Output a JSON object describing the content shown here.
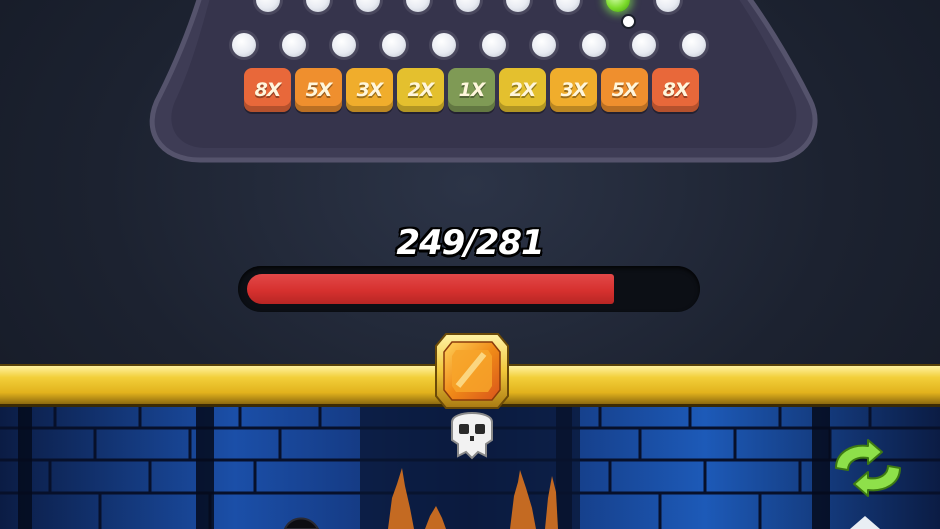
{
  "board": {
    "slots": [
      {
        "label": "8X",
        "color": "#e8683a"
      },
      {
        "label": "5X",
        "color": "#ef8f2e"
      },
      {
        "label": "3X",
        "color": "#f0ad2c"
      },
      {
        "label": "2X",
        "color": "#e4c02e"
      },
      {
        "label": "1X",
        "color": "#7f9a55"
      },
      {
        "label": "2X",
        "color": "#e4c02e"
      },
      {
        "label": "3X",
        "color": "#f0ad2c"
      },
      {
        "label": "5X",
        "color": "#ef8f2e"
      },
      {
        "label": "8X",
        "color": "#e8683a"
      }
    ],
    "hit_peg_color": "#7ddc2c"
  },
  "health": {
    "text": "249/281",
    "current": 249,
    "max": 281,
    "bar_color": "#d6312f"
  },
  "icons": {
    "gem": "orange-gem-icon",
    "skull": "skull-icon",
    "cycle": "green-cycle-arrows-icon"
  }
}
